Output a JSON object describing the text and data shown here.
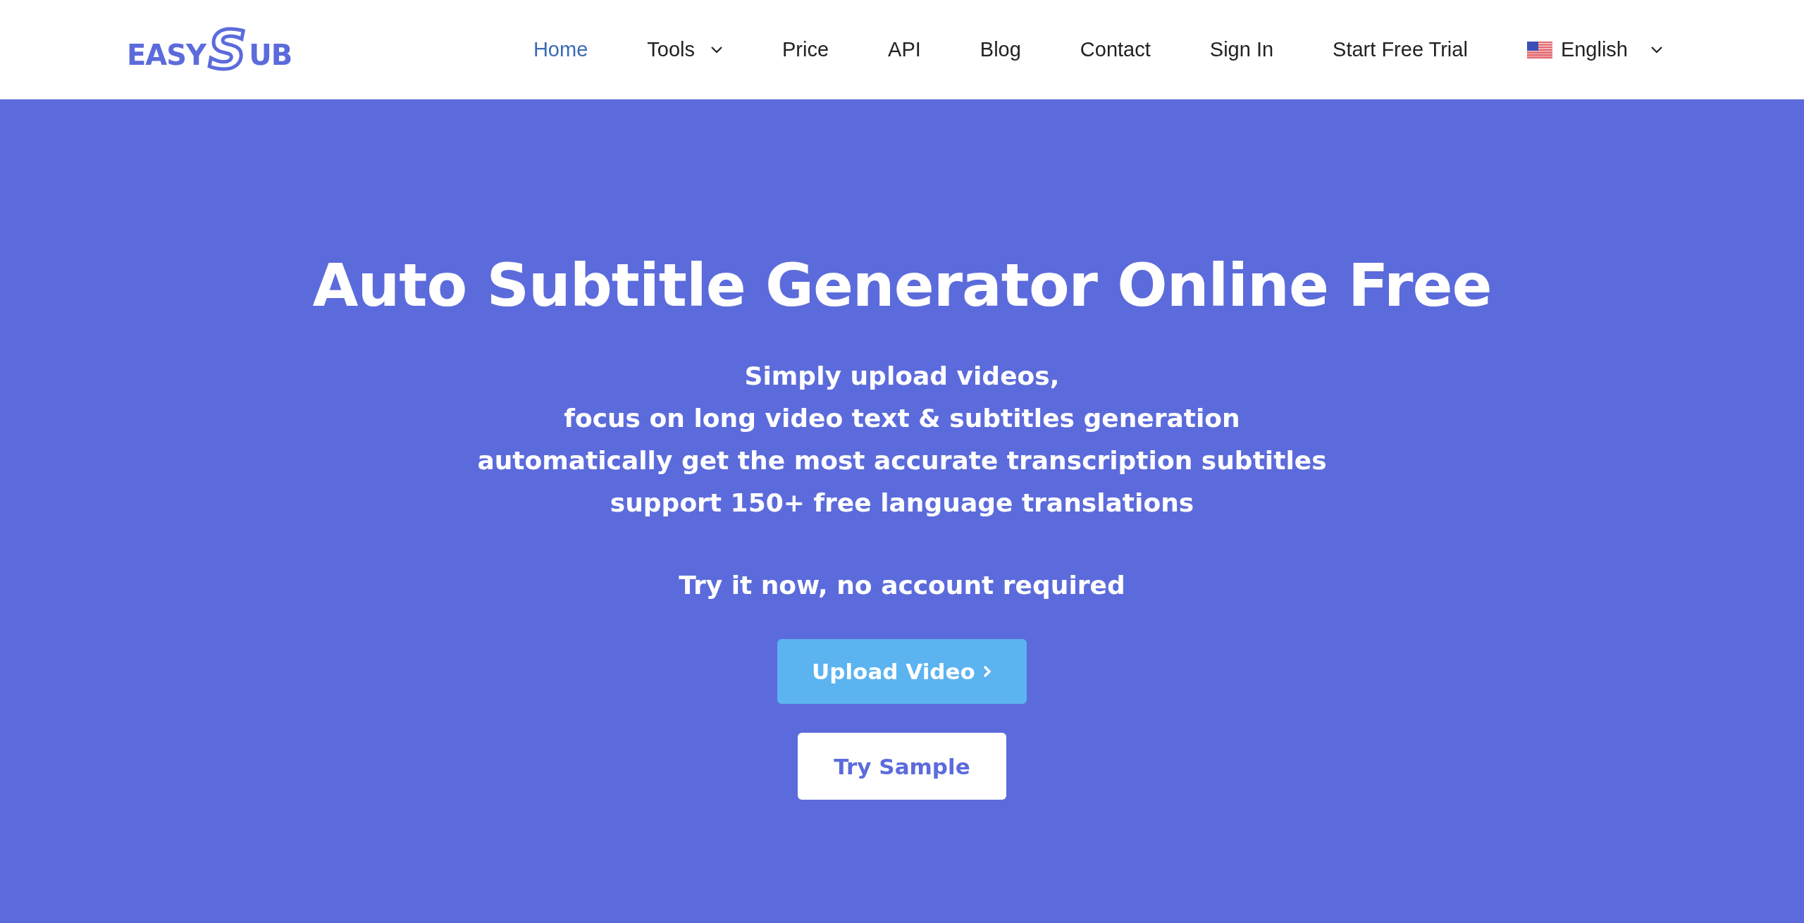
{
  "header": {
    "logo": {
      "prefix": "EASY",
      "mark": "S",
      "suffix": "UB"
    },
    "nav": [
      {
        "label": "Home",
        "selected": true,
        "has_menu": false
      },
      {
        "label": "Tools",
        "selected": false,
        "has_menu": true
      },
      {
        "label": "Price",
        "selected": false,
        "has_menu": false
      },
      {
        "label": "API",
        "selected": false,
        "has_menu": false
      },
      {
        "label": "Blog",
        "selected": false,
        "has_menu": false
      },
      {
        "label": "Contact",
        "selected": false,
        "has_menu": false
      },
      {
        "label": "Sign In",
        "selected": false,
        "has_menu": false
      },
      {
        "label": "Start Free Trial",
        "selected": false,
        "has_menu": false
      }
    ],
    "language": {
      "label": "English",
      "has_menu": true
    }
  },
  "hero": {
    "title": "Auto Subtitle Generator Online Free",
    "lines": [
      "Simply upload videos,",
      "focus on long video text & subtitles generation",
      "automatically get the most accurate transcription subtitles",
      "support 150+ free language translations"
    ],
    "note": "Try it now, no account required",
    "buttons": [
      {
        "label": "Upload Video",
        "kind": "primary"
      },
      {
        "label": "Try Sample",
        "kind": "secondary"
      }
    ]
  }
}
